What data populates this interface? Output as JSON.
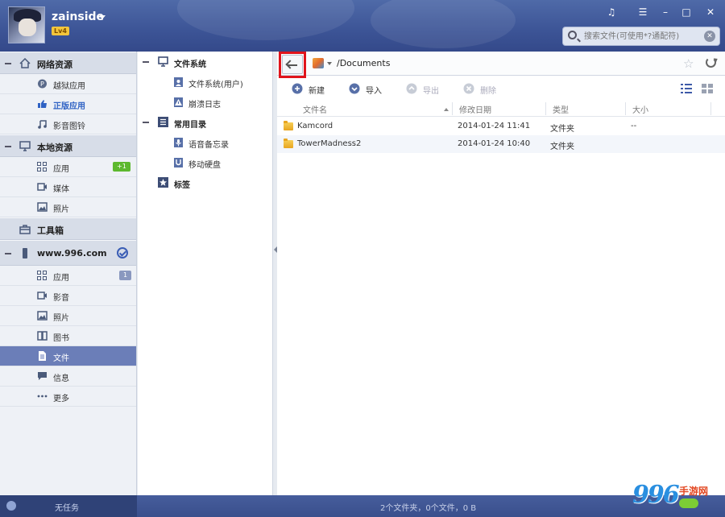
{
  "header": {
    "username": "zainside",
    "level": "Lv4",
    "window_buttons": [
      "♫",
      "☰",
      "–",
      "□",
      "✕"
    ],
    "search_placeholder": "搜索文件(可使用*?通配符)"
  },
  "sidebar": {
    "sections": [
      {
        "label": "网络资源",
        "icon": "cloud-home-icon",
        "items": [
          {
            "label": "越狱应用",
            "icon": "p-icon"
          },
          {
            "label": "正版应用",
            "icon": "thumbs-up-icon",
            "highlight": true
          },
          {
            "label": "影音图铃",
            "icon": "music-icon"
          }
        ]
      },
      {
        "label": "本地资源",
        "icon": "monitor-icon",
        "items": [
          {
            "label": "应用",
            "icon": "apps-grid-icon",
            "badge": "+1",
            "badge_color": "#5cb82e"
          },
          {
            "label": "媒体",
            "icon": "video-icon"
          },
          {
            "label": "照片",
            "icon": "photo-icon"
          }
        ]
      },
      {
        "label": "工具箱",
        "icon": "toolbox-icon",
        "items": []
      },
      {
        "label": "www.996.com",
        "icon": "phone-icon",
        "items": [
          {
            "label": "应用",
            "icon": "apps-grid-icon",
            "badge": "1",
            "badge_color": "#8a98bf"
          },
          {
            "label": "影音",
            "icon": "video-icon"
          },
          {
            "label": "照片",
            "icon": "photo-icon"
          },
          {
            "label": "图书",
            "icon": "book-icon"
          },
          {
            "label": "文件",
            "icon": "file-icon",
            "selected": true
          },
          {
            "label": "信息",
            "icon": "message-icon"
          },
          {
            "label": "更多",
            "icon": "more-icon"
          }
        ]
      }
    ]
  },
  "tree": {
    "groups": [
      {
        "label": "文件系统",
        "icon": "monitor-icon",
        "children": [
          {
            "label": "文件系统(用户)",
            "icon": "folder-user-icon"
          },
          {
            "label": "崩溃日志",
            "icon": "warning-icon"
          }
        ]
      },
      {
        "label": "常用目录",
        "icon": "list-icon",
        "children": [
          {
            "label": "语音备忘录",
            "icon": "voice-memo-icon"
          },
          {
            "label": "移动硬盘",
            "icon": "usb-drive-icon"
          }
        ]
      },
      {
        "label": "标签",
        "icon": "star-icon",
        "children": []
      }
    ]
  },
  "address": {
    "path": "/Documents"
  },
  "toolbar": {
    "new_label": "新建",
    "import_label": "导入",
    "export_label": "导出",
    "delete_label": "删除"
  },
  "table": {
    "columns": [
      "文件名",
      "修改日期",
      "类型",
      "大小"
    ],
    "rows": [
      {
        "name": "Kamcord",
        "date": "2014-01-24 11:41",
        "type": "文件夹",
        "size": "--"
      },
      {
        "name": "TowerMadness2",
        "date": "2014-01-24 10:40",
        "type": "文件夹",
        "size": ""
      }
    ]
  },
  "status": {
    "left_label": "无任务",
    "summary": "2个文件夹，0个文件，0 B"
  },
  "watermark": {
    "number": "996",
    "text": "手游网"
  },
  "colors": {
    "accent": "#3c5496",
    "selected": "#6b7eb8",
    "highlight_text": "#2f62c4",
    "annotation_red": "#e0141c"
  }
}
